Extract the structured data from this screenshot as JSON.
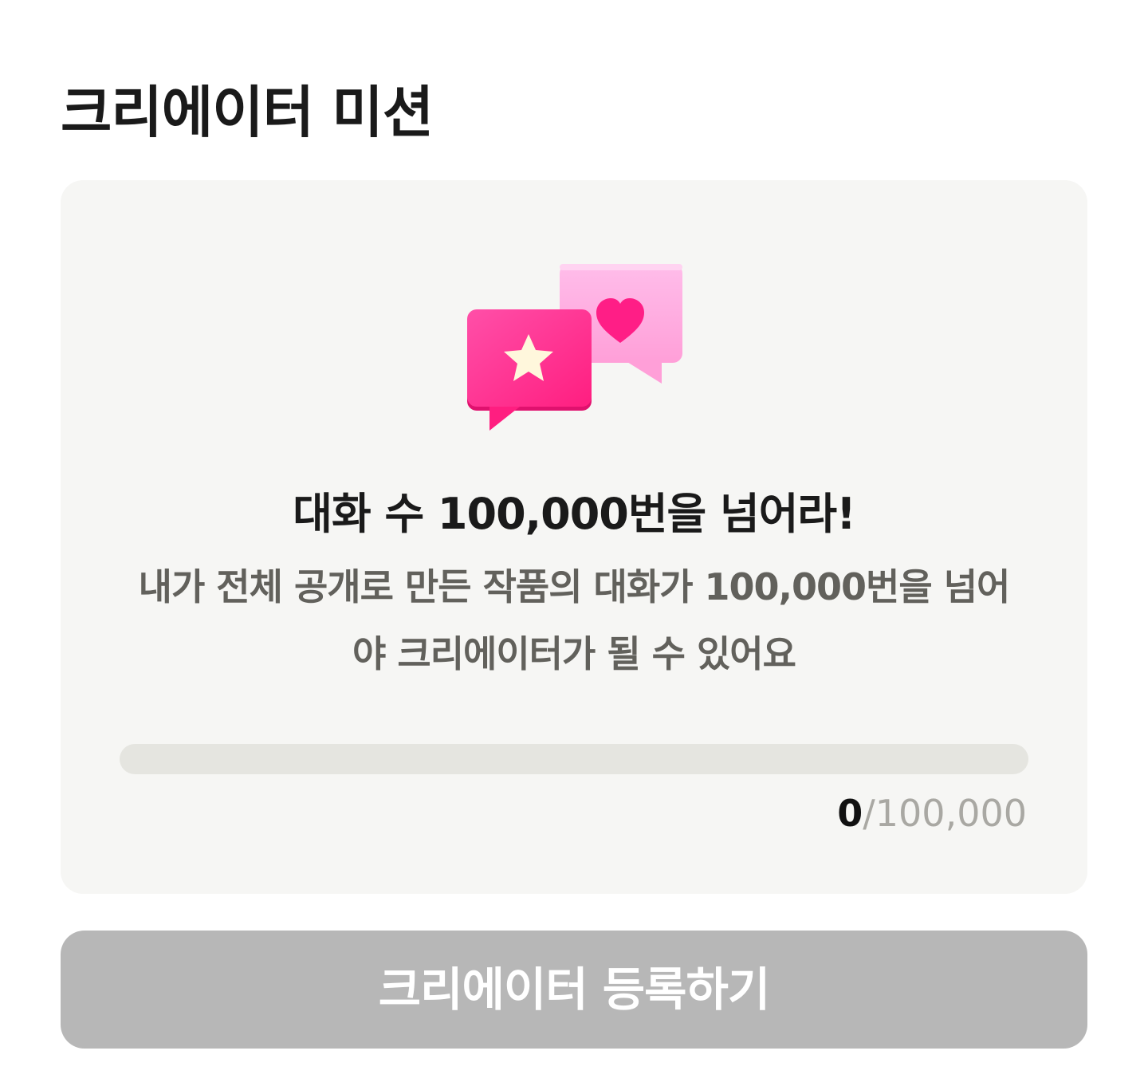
{
  "page": {
    "title": "크리에이터 미션"
  },
  "mission": {
    "icon": "chat-bubbles-star-heart-icon",
    "heading": "대화 수 100,000번을 넘어라!",
    "description": "내가 전체 공개로 만든 작품의 대화가 100,000번을 넘어야 크리에이터가 될 수 있어요",
    "progress": {
      "current": "0",
      "separator": "/",
      "goal": "100,000",
      "fraction": 0
    },
    "colors": {
      "accent_pink": "#ff2e86",
      "light_pink": "#ffb3e0",
      "star": "#fff7dc"
    }
  },
  "button": {
    "label": "크리에이터 등록하기",
    "state": "disabled"
  },
  "colors": {
    "card_bg": "#f6f6f4",
    "track_bg": "#e5e5e0",
    "button_bg": "#b7b7b7",
    "description_text": "#62615c",
    "goal_text": "#a9a8a3"
  }
}
